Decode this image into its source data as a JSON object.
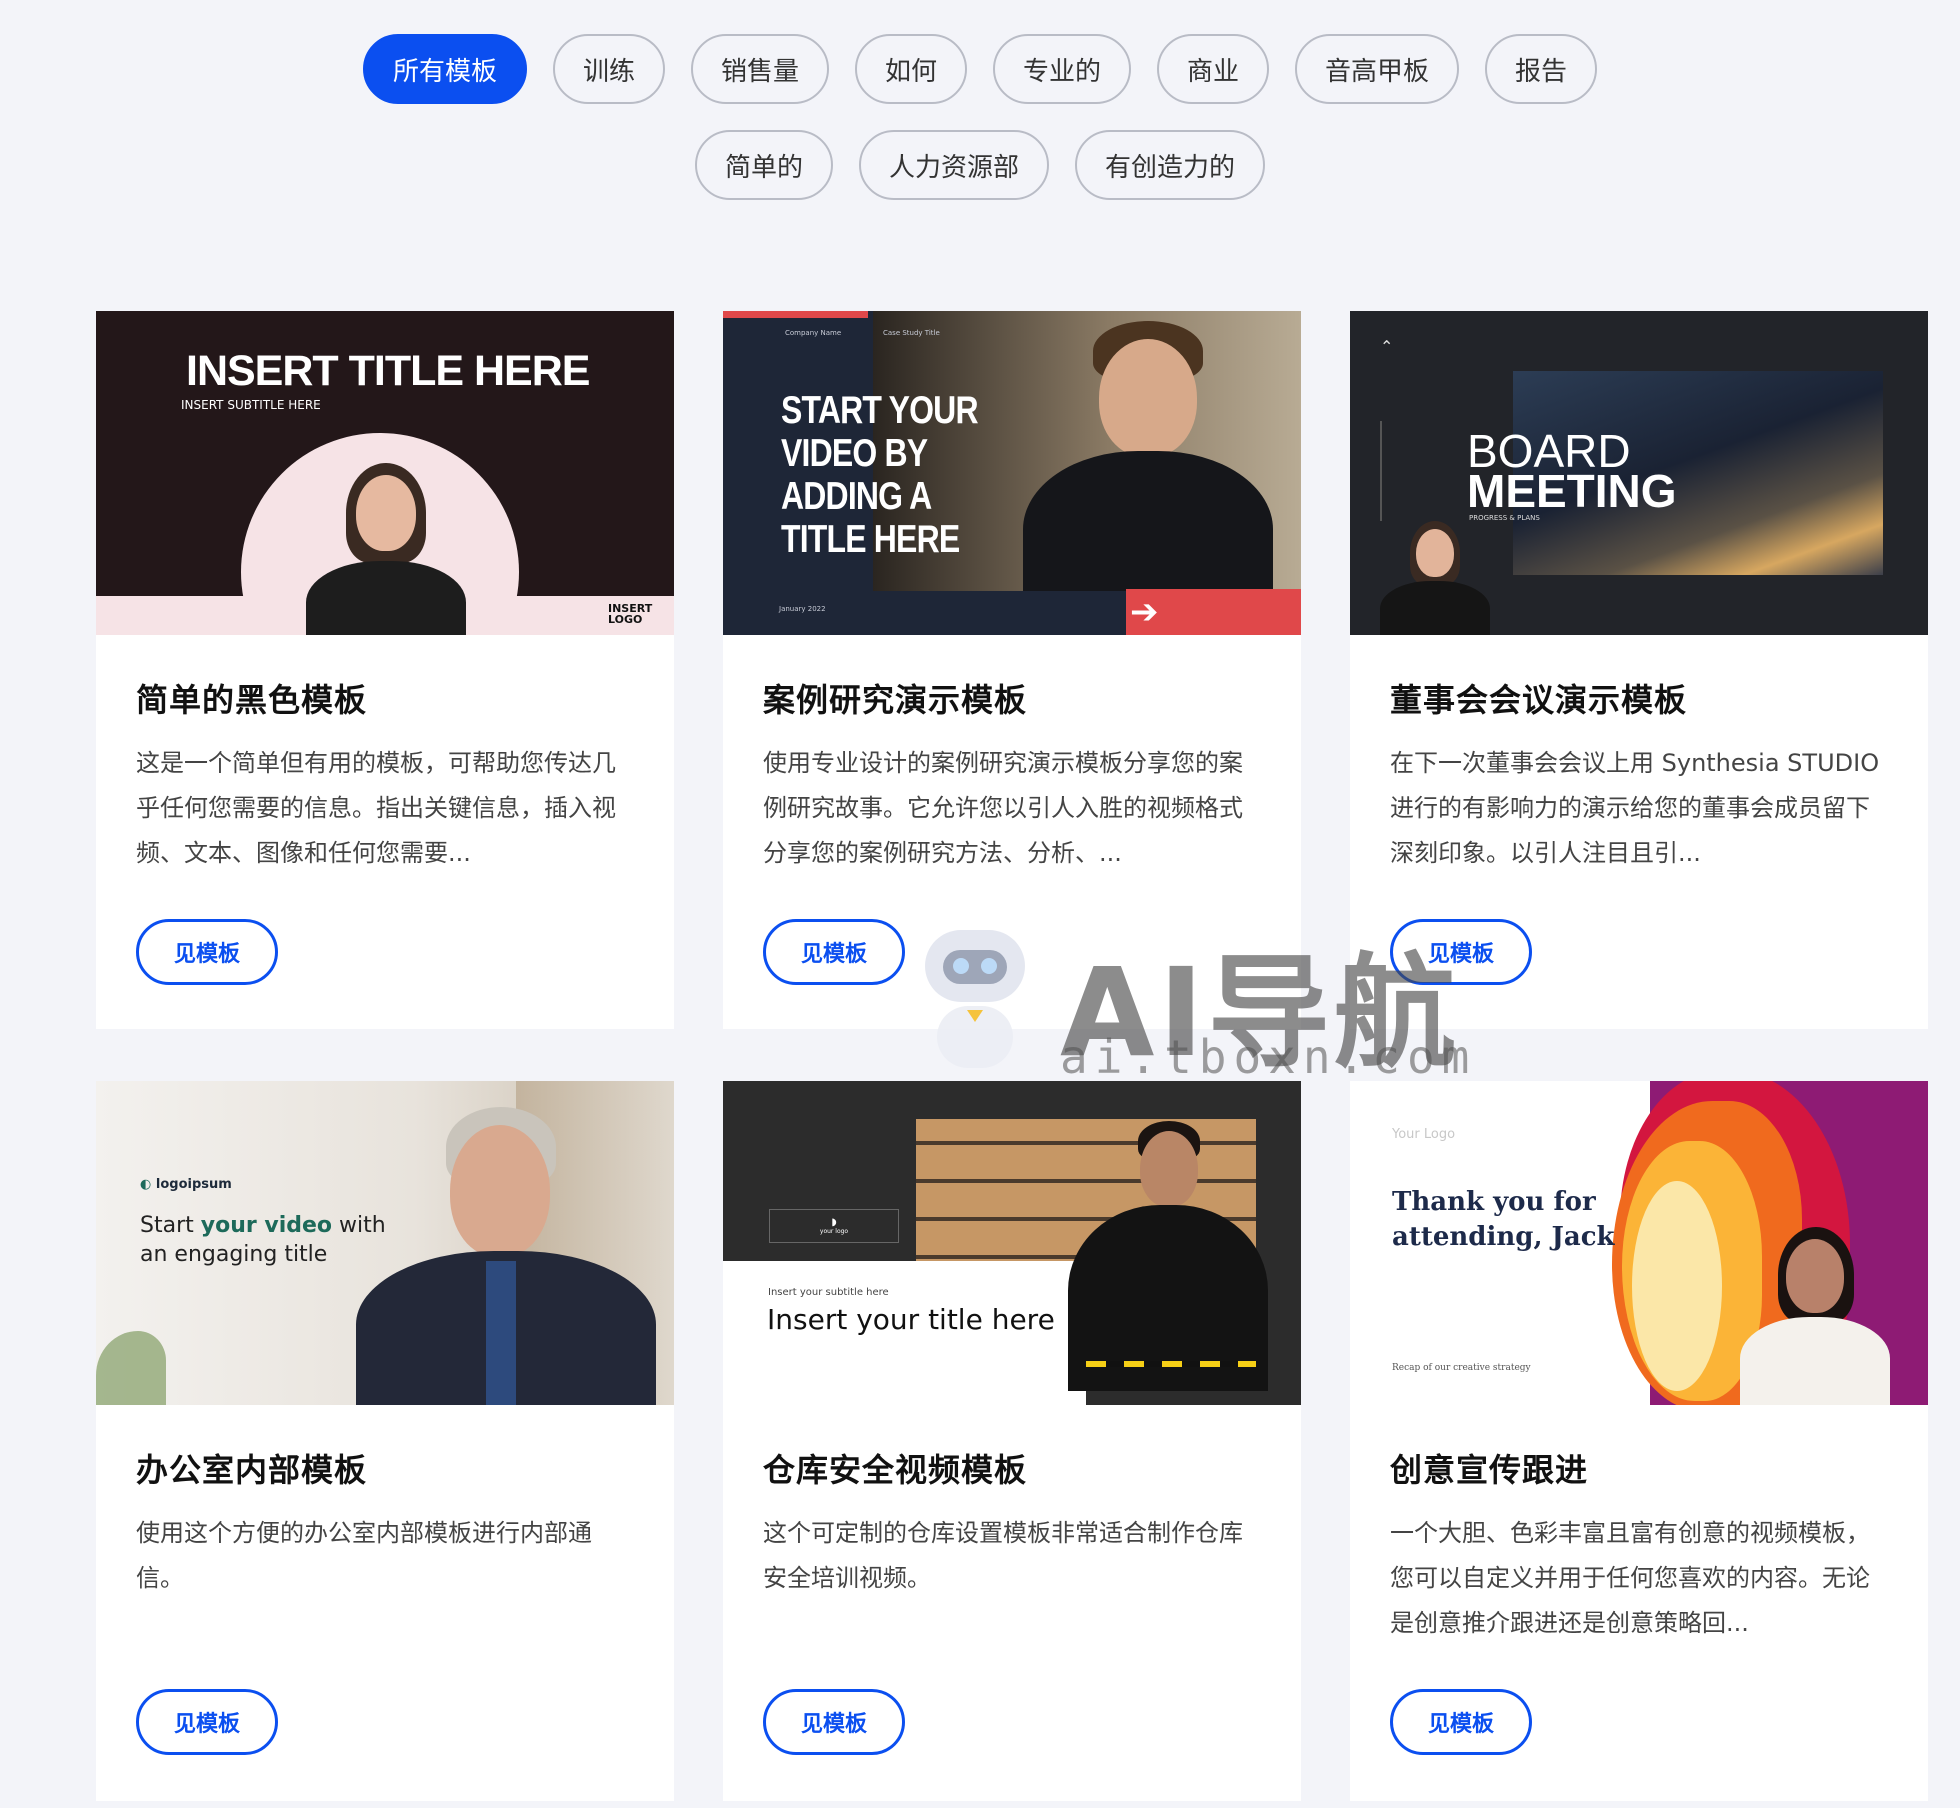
{
  "filters": {
    "row1": [
      "所有模板",
      "训练",
      "销售量",
      "如何",
      "专业的",
      "商业",
      "音高甲板",
      "报告"
    ],
    "row2": [
      "简单的",
      "人力资源部",
      "有创造力的"
    ],
    "active": "所有模板"
  },
  "cards": [
    {
      "title": "简单的黑色模板",
      "desc": "这是一个简单但有用的模板，可帮助您传达几乎任何您需要的信息。指出关键信息，插入视频、文本、图像和任何您需要...",
      "button": "见模板",
      "thumb": {
        "title": "INSERT TITLE HERE",
        "subtitle": "INSERT SUBTITLE HERE",
        "logo": "INSERT LOGO"
      }
    },
    {
      "title": "案例研究演示模板",
      "desc": "使用专业设计的案例研究演示模板分享您的案例研究故事。它允许您以引人入胜的视频格式分享您的案例研究方法、分析、...",
      "button": "见模板",
      "thumb": {
        "company": "Company Name",
        "case": "Case Study Title",
        "title": "START YOUR VIDEO BY ADDING A TITLE HERE",
        "date": "January 2022"
      }
    },
    {
      "title": "董事会会议演示模板",
      "desc": "在下一次董事会会议上用 Synthesia STUDIO 进行的有影响力的演示给您的董事会成员留下深刻印象。以引人注目且引...",
      "button": "见模板",
      "thumb": {
        "title1": "BOARD",
        "title2": "MEETING",
        "sub": "PROGRESS & PLANS"
      }
    },
    {
      "title": "办公室内部模板",
      "desc": "使用这个方便的办公室内部模板进行内部通信。",
      "button": "见模板",
      "thumb": {
        "logo": "logoipsum",
        "line1a": "Start ",
        "line1b": "your video",
        "line1c": " with",
        "line2": "an engaging title"
      }
    },
    {
      "title": "仓库安全视频模板",
      "desc": "这个可定制的仓库设置模板非常适合制作仓库安全培训视频。",
      "button": "见模板",
      "thumb": {
        "logo": "your logo",
        "subtitle": "Insert your subtitle here",
        "title": "Insert your title here"
      }
    },
    {
      "title": "创意宣传跟进",
      "desc": "一个大胆、色彩丰富且富有创意的视频模板，您可以自定义并用于任何您喜欢的内容。无论是创意推介跟进还是创意策略回...",
      "button": "见模板",
      "thumb": {
        "logo": "Your Logo",
        "title1": "Thank you for",
        "title2": "attending, Jack",
        "sub": "Recap of our creative strategy"
      }
    }
  ],
  "watermark": {
    "text": "AI导航",
    "url": "ai.tboxn.com"
  },
  "colors": {
    "accent": "#0b4ff0",
    "background": "#f3f4f9"
  }
}
